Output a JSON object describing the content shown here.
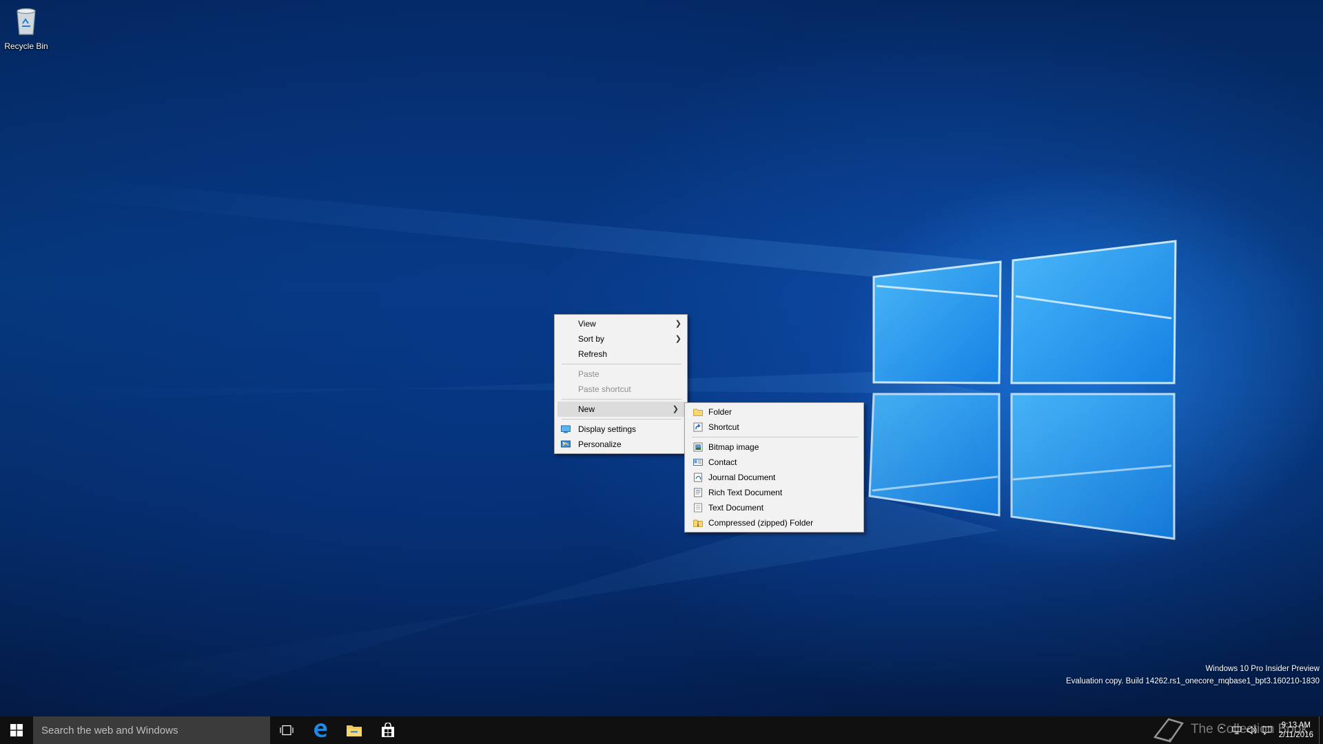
{
  "desktop": {
    "icons": [
      {
        "label": "Recycle Bin",
        "icon": "recycle-bin-icon"
      }
    ]
  },
  "context_menu": {
    "items": [
      {
        "label": "View",
        "has_submenu": true,
        "enabled": true
      },
      {
        "label": "Sort by",
        "has_submenu": true,
        "enabled": true
      },
      {
        "label": "Refresh",
        "enabled": true
      },
      {
        "label": "Paste",
        "enabled": false
      },
      {
        "label": "Paste shortcut",
        "enabled": false
      },
      {
        "label": "New",
        "has_submenu": true,
        "enabled": true,
        "highlighted": true
      },
      {
        "label": "Display settings",
        "icon": "display-settings-icon",
        "enabled": true
      },
      {
        "label": "Personalize",
        "icon": "personalize-icon",
        "enabled": true
      }
    ]
  },
  "new_submenu": {
    "items": [
      {
        "label": "Folder",
        "icon": "folder-icon"
      },
      {
        "label": "Shortcut",
        "icon": "shortcut-icon"
      },
      {
        "label": "Bitmap image",
        "icon": "bitmap-icon"
      },
      {
        "label": "Contact",
        "icon": "contact-icon"
      },
      {
        "label": "Journal Document",
        "icon": "journal-icon"
      },
      {
        "label": "Rich Text Document",
        "icon": "rich-text-icon"
      },
      {
        "label": "Text Document",
        "icon": "text-document-icon"
      },
      {
        "label": "Compressed (zipped) Folder",
        "icon": "zip-folder-icon"
      }
    ]
  },
  "watermark": {
    "edition": "Windows 10 Pro Insider Preview",
    "build": "Evaluation copy. Build 14262.rs1_onecore_mqbase1_bpt3.160210-1830",
    "site": "The Collection Book"
  },
  "taskbar": {
    "search_placeholder": "Search the web and Windows",
    "pinned": [
      "task-view-icon",
      "edge-icon",
      "file-explorer-icon",
      "store-icon"
    ],
    "tray_icons": [
      "chevron-up-icon",
      "network-icon",
      "volume-icon",
      "action-center-icon"
    ],
    "clock_time": "9:13 AM",
    "clock_date": "2/11/2016"
  },
  "colors": {
    "accent": "#0078d7",
    "menu_bg": "#f2f2f2",
    "taskbar_bg": "#101010",
    "search_bg": "#3b3b3b"
  }
}
